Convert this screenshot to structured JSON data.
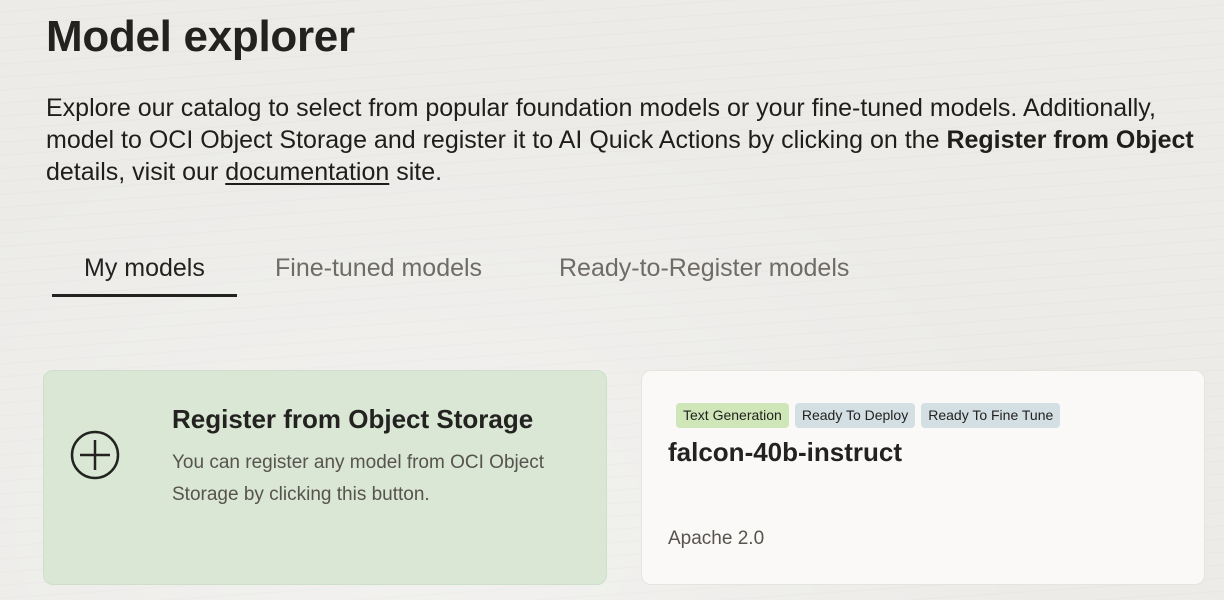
{
  "page": {
    "title": "Model explorer",
    "intro": {
      "line1": "Explore our catalog to select from popular foundation models or your fine-tuned models. Additionally,",
      "line2_prefix": "model to OCI Object Storage and register it to AI Quick Actions by clicking on the ",
      "line2_bold": "Register from Object",
      "line3_prefix": "details, visit our ",
      "line3_link": "documentation",
      "line3_suffix": " site."
    }
  },
  "tabs": [
    {
      "label": "My models",
      "active": true
    },
    {
      "label": "Fine-tuned models",
      "active": false
    },
    {
      "label": "Ready-to-Register models",
      "active": false
    }
  ],
  "cards": {
    "register": {
      "icon": "plus-circle-icon",
      "title": "Register from Object Storage",
      "description": "You can register any model from OCI Object Storage by clicking this button."
    },
    "model": {
      "tags": [
        "Text Generation",
        "Ready To Deploy",
        "Ready To Fine Tune"
      ],
      "name": "falcon-40b-instruct",
      "license": "Apache 2.0"
    }
  },
  "colors": {
    "register_card_bg": "#d9e7d4",
    "tag_green": "#cfe6b8",
    "tag_blue": "#d3dfe3"
  }
}
